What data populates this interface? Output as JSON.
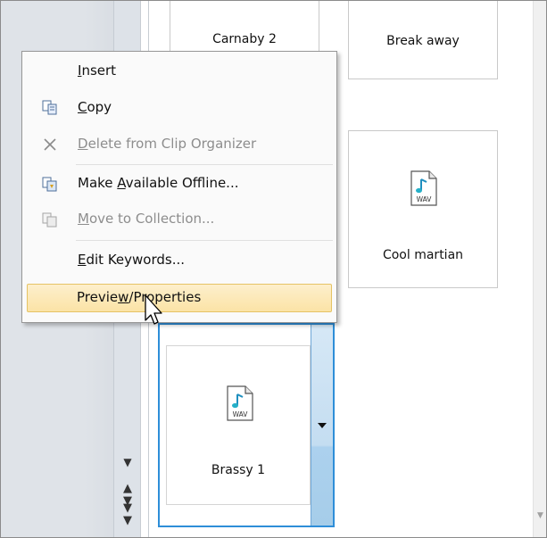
{
  "clips": {
    "top_left_label": "Carnaby 2",
    "top_right_label": "Break away",
    "middle_right_label": "Cool martian",
    "selected_label": "Brassy 1",
    "wav_text": "WAV"
  },
  "menu": {
    "items": [
      {
        "label": "Insert",
        "mnemonic": "I",
        "disabled": false
      },
      {
        "label": "Copy",
        "mnemonic": "C",
        "disabled": false
      },
      {
        "label": "Delete from Clip Organizer",
        "mnemonic": "D",
        "disabled": true
      },
      {
        "label": "Make Available Offline...",
        "mnemonic": "A",
        "disabled": false
      },
      {
        "label": "Move to Collection...",
        "mnemonic": "M",
        "disabled": true
      },
      {
        "label": "Edit Keywords...",
        "mnemonic": "E",
        "disabled": false
      },
      {
        "label": "Preview/Properties",
        "mnemonic": "w",
        "disabled": false,
        "hovered": true
      }
    ]
  },
  "colors": {
    "selection_border": "#2e8ed8",
    "hover_fill": "#fbe3a6",
    "disabled_text": "#8d8d8d"
  }
}
